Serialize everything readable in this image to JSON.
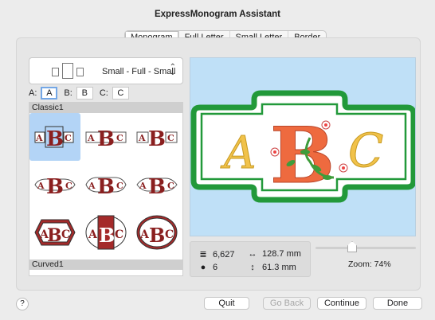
{
  "window": {
    "title": "ExpressMonogram Assistant"
  },
  "tabs": [
    {
      "label": "Monogram",
      "active": true
    },
    {
      "label": "Full Letter"
    },
    {
      "label": "Small Letter"
    },
    {
      "label": "Border"
    }
  ],
  "layout": {
    "selected": "Small - Full - Small"
  },
  "letters": [
    {
      "label": "A:",
      "value": "A"
    },
    {
      "label": "B:",
      "value": "B"
    },
    {
      "label": "C:",
      "value": "C"
    }
  ],
  "gallery": {
    "groups": [
      {
        "name": "Classic1",
        "selected_index": 0
      },
      {
        "name": "Curved1"
      }
    ],
    "item_count": 9
  },
  "preview": {
    "letters": [
      "A",
      "B",
      "C"
    ],
    "colors": {
      "background": "#bfe0f7",
      "border": "#22993a",
      "small_letters": "#f1c24a",
      "full_letter": "#ee6a3f",
      "leaves": "#3e9c3b"
    }
  },
  "stats": {
    "stitches": "6,627",
    "width": "128.7 mm",
    "colors": "6",
    "height": "61.3 mm"
  },
  "zoom": {
    "label": "Zoom: 74%",
    "value_percent": 74
  },
  "buttons": {
    "help": "?",
    "quit": "Quit",
    "go_back": "Go Back",
    "continue": "Continue",
    "done": "Done"
  }
}
